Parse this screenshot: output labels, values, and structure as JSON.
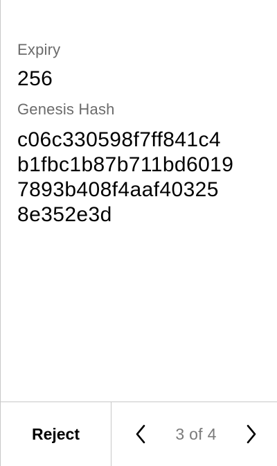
{
  "fields": {
    "expiry": {
      "label": "Expiry",
      "value": "256"
    },
    "genesis_hash": {
      "label": "Genesis Hash",
      "value_lines": [
        "c06c330598f7ff841c4",
        "b1fbc1b87b711bd6019",
        "7893b408f4aaf40325",
        "8e352e3d"
      ]
    }
  },
  "footer": {
    "reject_label": "Reject",
    "pager": {
      "indicator": "3 of 4",
      "prev_icon": "chevron-left-icon",
      "next_icon": "chevron-right-icon"
    }
  },
  "colors": {
    "label": "#6b6b6b",
    "value": "#000000",
    "divider": "#c8c8c8",
    "pager_text": "#7a7a7a"
  }
}
